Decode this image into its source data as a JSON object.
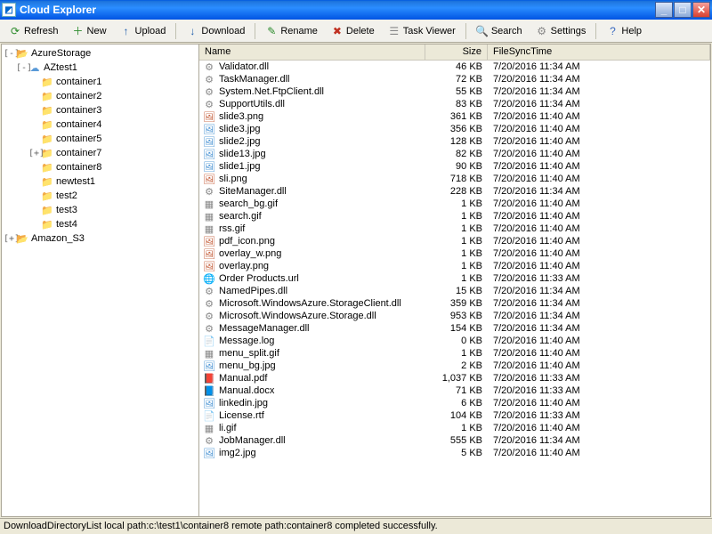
{
  "window": {
    "title": "Cloud Explorer"
  },
  "toolbar": {
    "refresh": "Refresh",
    "new": "New",
    "upload": "Upload",
    "download": "Download",
    "rename": "Rename",
    "delete": "Delete",
    "taskviewer": "Task Viewer",
    "search": "Search",
    "settings": "Settings",
    "help": "Help"
  },
  "tree": {
    "items": [
      {
        "label": "AzureStorage",
        "level": 0,
        "expander": "-",
        "icon": "folder-open"
      },
      {
        "label": "AZtest1",
        "level": 1,
        "expander": "-",
        "icon": "cloud"
      },
      {
        "label": "container1",
        "level": 2,
        "expander": "",
        "icon": "folder"
      },
      {
        "label": "container2",
        "level": 2,
        "expander": "",
        "icon": "folder"
      },
      {
        "label": "container3",
        "level": 2,
        "expander": "",
        "icon": "folder"
      },
      {
        "label": "container4",
        "level": 2,
        "expander": "",
        "icon": "folder"
      },
      {
        "label": "container5",
        "level": 2,
        "expander": "",
        "icon": "folder"
      },
      {
        "label": "container7",
        "level": 2,
        "expander": "+",
        "icon": "folder"
      },
      {
        "label": "container8",
        "level": 2,
        "expander": "",
        "icon": "folder"
      },
      {
        "label": "newtest1",
        "level": 2,
        "expander": "",
        "icon": "folder"
      },
      {
        "label": "test2",
        "level": 2,
        "expander": "",
        "icon": "folder"
      },
      {
        "label": "test3",
        "level": 2,
        "expander": "",
        "icon": "folder"
      },
      {
        "label": "test4",
        "level": 2,
        "expander": "",
        "icon": "folder"
      },
      {
        "label": "Amazon_S3",
        "level": 0,
        "expander": "+",
        "icon": "folder-open"
      }
    ]
  },
  "columns": {
    "name": "Name",
    "size": "Size",
    "time": "FileSyncTime"
  },
  "files": [
    {
      "name": "Validator.dll",
      "size": "46 KB",
      "time": "7/20/2016 11:34 AM",
      "icon": "dll"
    },
    {
      "name": "TaskManager.dll",
      "size": "72 KB",
      "time": "7/20/2016 11:34 AM",
      "icon": "dll"
    },
    {
      "name": "System.Net.FtpClient.dll",
      "size": "55 KB",
      "time": "7/20/2016 11:34 AM",
      "icon": "dll"
    },
    {
      "name": "SupportUtils.dll",
      "size": "83 KB",
      "time": "7/20/2016 11:34 AM",
      "icon": "dll"
    },
    {
      "name": "slide3.png",
      "size": "361 KB",
      "time": "7/20/2016 11:40 AM",
      "icon": "png"
    },
    {
      "name": "slide3.jpg",
      "size": "356 KB",
      "time": "7/20/2016 11:40 AM",
      "icon": "jpg"
    },
    {
      "name": "slide2.jpg",
      "size": "128 KB",
      "time": "7/20/2016 11:40 AM",
      "icon": "jpg"
    },
    {
      "name": "slide13.jpg",
      "size": "82 KB",
      "time": "7/20/2016 11:40 AM",
      "icon": "jpg"
    },
    {
      "name": "slide1.jpg",
      "size": "90 KB",
      "time": "7/20/2016 11:40 AM",
      "icon": "jpg"
    },
    {
      "name": "sli.png",
      "size": "718 KB",
      "time": "7/20/2016 11:40 AM",
      "icon": "png"
    },
    {
      "name": "SiteManager.dll",
      "size": "228 KB",
      "time": "7/20/2016 11:34 AM",
      "icon": "dll"
    },
    {
      "name": "search_bg.gif",
      "size": "1 KB",
      "time": "7/20/2016 11:40 AM",
      "icon": "gif"
    },
    {
      "name": "search.gif",
      "size": "1 KB",
      "time": "7/20/2016 11:40 AM",
      "icon": "gif"
    },
    {
      "name": "rss.gif",
      "size": "1 KB",
      "time": "7/20/2016 11:40 AM",
      "icon": "gif"
    },
    {
      "name": "pdf_icon.png",
      "size": "1 KB",
      "time": "7/20/2016 11:40 AM",
      "icon": "png"
    },
    {
      "name": "overlay_w.png",
      "size": "1 KB",
      "time": "7/20/2016 11:40 AM",
      "icon": "png"
    },
    {
      "name": "overlay.png",
      "size": "1 KB",
      "time": "7/20/2016 11:40 AM",
      "icon": "png"
    },
    {
      "name": "Order Products.url",
      "size": "1 KB",
      "time": "7/20/2016 11:33 AM",
      "icon": "url"
    },
    {
      "name": "NamedPipes.dll",
      "size": "15 KB",
      "time": "7/20/2016 11:34 AM",
      "icon": "dll"
    },
    {
      "name": "Microsoft.WindowsAzure.StorageClient.dll",
      "size": "359 KB",
      "time": "7/20/2016 11:34 AM",
      "icon": "dll"
    },
    {
      "name": "Microsoft.WindowsAzure.Storage.dll",
      "size": "953 KB",
      "time": "7/20/2016 11:34 AM",
      "icon": "dll"
    },
    {
      "name": "MessageManager.dll",
      "size": "154 KB",
      "time": "7/20/2016 11:34 AM",
      "icon": "dll"
    },
    {
      "name": "Message.log",
      "size": "0 KB",
      "time": "7/20/2016 11:40 AM",
      "icon": "log"
    },
    {
      "name": "menu_split.gif",
      "size": "1 KB",
      "time": "7/20/2016 11:40 AM",
      "icon": "gif"
    },
    {
      "name": "menu_bg.jpg",
      "size": "2 KB",
      "time": "7/20/2016 11:40 AM",
      "icon": "jpg"
    },
    {
      "name": "Manual.pdf",
      "size": "1,037 KB",
      "time": "7/20/2016 11:33 AM",
      "icon": "pdf"
    },
    {
      "name": "Manual.docx",
      "size": "71 KB",
      "time": "7/20/2016 11:33 AM",
      "icon": "docx"
    },
    {
      "name": "linkedin.jpg",
      "size": "6 KB",
      "time": "7/20/2016 11:40 AM",
      "icon": "jpg"
    },
    {
      "name": "License.rtf",
      "size": "104 KB",
      "time": "7/20/2016 11:33 AM",
      "icon": "rtf"
    },
    {
      "name": "li.gif",
      "size": "1 KB",
      "time": "7/20/2016 11:40 AM",
      "icon": "gif"
    },
    {
      "name": "JobManager.dll",
      "size": "555 KB",
      "time": "7/20/2016 11:34 AM",
      "icon": "dll"
    },
    {
      "name": "img2.jpg",
      "size": "5 KB",
      "time": "7/20/2016 11:40 AM",
      "icon": "jpg"
    }
  ],
  "statusbar": {
    "text": "DownloadDirectoryList local path:c:\\test1\\container8 remote path:container8 completed successfully."
  }
}
